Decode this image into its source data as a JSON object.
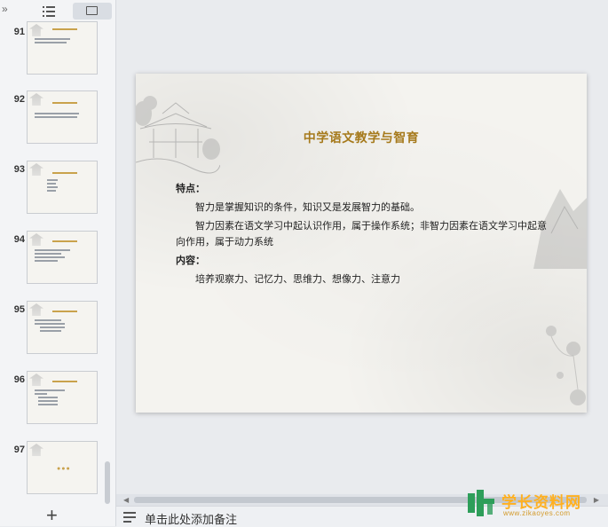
{
  "sidebar": {
    "thumbnails": [
      {
        "number": "91"
      },
      {
        "number": "92"
      },
      {
        "number": "93"
      },
      {
        "number": "94"
      },
      {
        "number": "95"
      },
      {
        "number": "96"
      },
      {
        "number": "97"
      }
    ],
    "add_slide_label": "+"
  },
  "slide": {
    "title": "中学语文教学与智育",
    "features_heading": "特点：",
    "features_p1": "智力是掌握知识的条件，知识又是发展智力的基础。",
    "features_p2": "智力因素在语文学习中起认识作用，属于操作系统；非智力因素在语文学习中起意向作用，属于动力系统",
    "content_heading": "内容：",
    "content_p1": "培养观察力、记忆力、思维力、想像力、注意力"
  },
  "notes": {
    "placeholder": "单击此处添加备注"
  },
  "watermark": {
    "text": "学长资料网",
    "url": "www.zikaoyes.com"
  },
  "colors": {
    "title_gold": "#a67a1c",
    "watermark_orange": "#ffb020",
    "watermark_green": "#2e9e5a"
  }
}
